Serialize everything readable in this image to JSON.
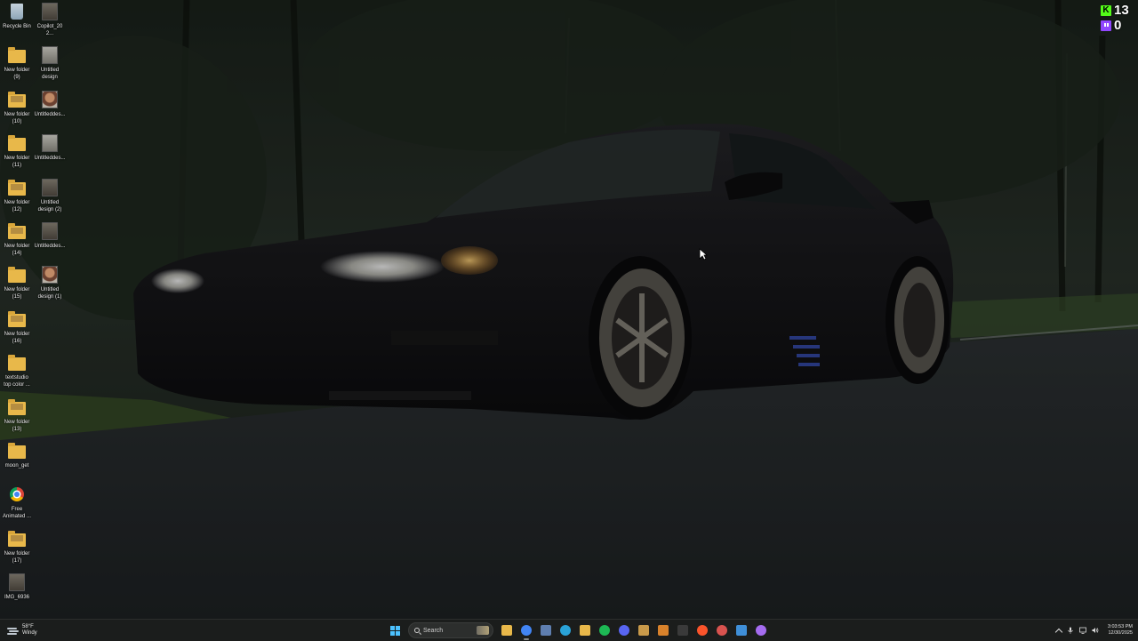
{
  "desktop": {
    "icons": [
      {
        "label": "Recycle Bin",
        "icon": "recycle-bin-icon",
        "kind": "recycle"
      },
      {
        "label": "Copilot_202...",
        "icon": "image-file-icon",
        "kind": "pic"
      },
      {
        "label": "New folder\n(9)",
        "icon": "folder-icon",
        "kind": "folder"
      },
      {
        "label": "Untitled\ndesign",
        "icon": "image-file-icon",
        "kind": "gray"
      },
      {
        "label": "New folder\n(10)",
        "icon": "folder-icon",
        "kind": "folder-thumb"
      },
      {
        "label": "Untitleddes...",
        "icon": "image-file-icon",
        "kind": "face"
      },
      {
        "label": "New folder\n(11)",
        "icon": "folder-icon",
        "kind": "folder"
      },
      {
        "label": "Untitleddes...",
        "icon": "image-file-icon",
        "kind": "gray"
      },
      {
        "label": "New folder\n(12)",
        "icon": "folder-icon",
        "kind": "folder-thumb"
      },
      {
        "label": "Untitled\ndesign (2)",
        "icon": "image-file-icon",
        "kind": "pic"
      },
      {
        "label": "New folder\n(14)",
        "icon": "folder-icon",
        "kind": "folder-thumb"
      },
      {
        "label": "Untitleddes...",
        "icon": "image-file-icon",
        "kind": "pic"
      },
      {
        "label": "New folder\n(15)",
        "icon": "folder-icon",
        "kind": "folder"
      },
      {
        "label": "Untitled\ndesign (1)",
        "icon": "image-file-icon",
        "kind": "face"
      },
      {
        "label": "New folder\n(16)",
        "icon": "folder-icon",
        "kind": "folder-thumb"
      },
      {
        "label": "textstudio\ntop color ...",
        "icon": "folder-icon",
        "kind": "folder"
      },
      {
        "label": "New folder\n(13)",
        "icon": "folder-icon",
        "kind": "folder-thumb"
      },
      {
        "label": "moon_get",
        "icon": "folder-icon",
        "kind": "folder"
      },
      {
        "label": "Free\nAnimated ...",
        "icon": "chrome-shortcut-icon",
        "kind": "chrome"
      },
      {
        "label": "New folder\n(17)",
        "icon": "folder-icon",
        "kind": "folder-thumb"
      },
      {
        "label": "IMG_6936",
        "icon": "image-file-icon",
        "kind": "pic"
      }
    ]
  },
  "overlay": {
    "kick_letter": "K",
    "kick_count": "13",
    "twitch_count": "0",
    "kick_color": "#53fc18",
    "twitch_color": "#9146ff"
  },
  "taskbar": {
    "weather_temp": "58°F",
    "weather_desc": "Windy",
    "search_placeholder": "Search",
    "apps": [
      {
        "name": "file-explorer-icon",
        "color": "#e8b84a"
      },
      {
        "name": "chrome-icon",
        "color": "#4285f4",
        "active": true
      },
      {
        "name": "snipping-tool-icon",
        "color": "#5f7fb0"
      },
      {
        "name": "edge-icon",
        "color": "#2aa3d8"
      },
      {
        "name": "folder-icon",
        "color": "#e8b84a"
      },
      {
        "name": "spotify-icon",
        "color": "#1db954"
      },
      {
        "name": "discord-icon",
        "color": "#5865f2"
      },
      {
        "name": "app-icon",
        "color": "#c99a4a"
      },
      {
        "name": "office-icon",
        "color": "#d9822b"
      },
      {
        "name": "terminal-icon",
        "color": "#3a3a3a"
      },
      {
        "name": "brave-icon",
        "color": "#fb542b"
      },
      {
        "name": "settings-app-icon",
        "color": "#d9534f"
      },
      {
        "name": "photos-icon",
        "color": "#3f8fd8"
      },
      {
        "name": "obs-icon",
        "color": "#a56cf0"
      }
    ],
    "clock_time": "3:03:53 PM",
    "clock_date": "12/30/2025"
  }
}
